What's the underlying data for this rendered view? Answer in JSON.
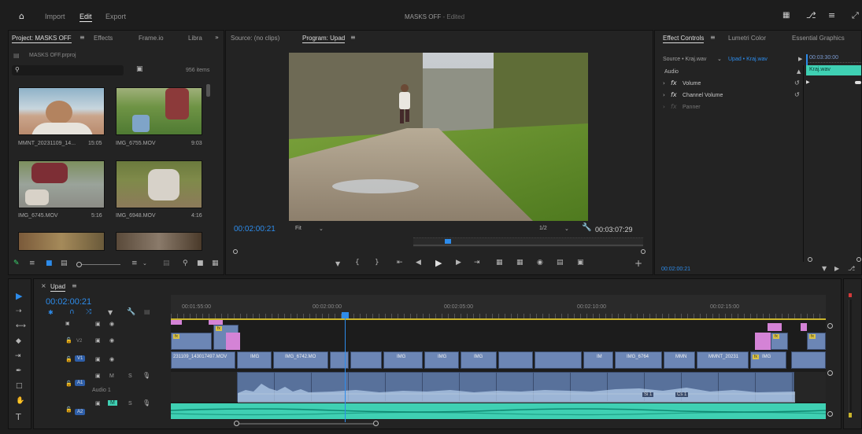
{
  "topbar": {
    "import": "Import",
    "edit": "Edit",
    "export": "Export",
    "title": "MASKS OFF",
    "edited": "- Edited"
  },
  "project": {
    "tabs": [
      "Project: MASKS OFF",
      "Effects",
      "Frame.io",
      "Libra"
    ],
    "file": "MASKS OFF.prproj",
    "item_count": "956 items",
    "thumbs": [
      {
        "name": "MMNT_20231109_14...",
        "dur": "15:05"
      },
      {
        "name": "IMG_6755.MOV",
        "dur": "9:03"
      },
      {
        "name": "IMG_6745.MOV",
        "dur": "5:16"
      },
      {
        "name": "IMG_6948.MOV",
        "dur": "4:16"
      }
    ]
  },
  "source": {
    "tab_source": "Source: (no clips)",
    "tab_program": "Program: Upad",
    "timecode": "00:02:00:21",
    "fit": "Fit",
    "ratio": "1/2",
    "duration": "00:03:07:29"
  },
  "effects": {
    "tabs": [
      "Effect Controls",
      "Lumetri Color",
      "Essential Graphics"
    ],
    "source_label": "Source • Kraj.wav",
    "clip_label": "Upad • Kraj.wav",
    "ruler_tc": "00:03:30:00",
    "clip_name": "Kraj.wav",
    "section": "Audio",
    "items": [
      "Volume",
      "Channel Volume",
      "Panner"
    ],
    "timecode": "00:02:00:21"
  },
  "timeline": {
    "tab": "Upad",
    "timecode": "00:02:00:21",
    "ruler": [
      "00:01:55:00",
      "00:02:00:00",
      "00:02:05:00",
      "00:02:10:00",
      "00:02:15:00"
    ],
    "tracks": {
      "v3": "V3",
      "v2": "V2",
      "v1": "V1",
      "a1": "A1",
      "a2": "A2",
      "audio1": "Audio 1",
      "m": "M",
      "s": "S"
    },
    "clips": [
      "231109_143017497.MOV",
      "IMG",
      "IMG_6742.MO",
      "IMG",
      "IMG",
      "IMG",
      "IM",
      "IMG_6764",
      "MMN",
      "MMNT_20231",
      "IMG"
    ],
    "clip_fx": "fx",
    "audio_tags": [
      "Si 1",
      "Cs 1"
    ]
  },
  "colors": {
    "accent": "#2d8ceb",
    "video_clip": "#6c86b5",
    "audio_teal": "#3fd0b3",
    "pink": "#d483d6",
    "fx_yellow": "#d8c24a"
  }
}
